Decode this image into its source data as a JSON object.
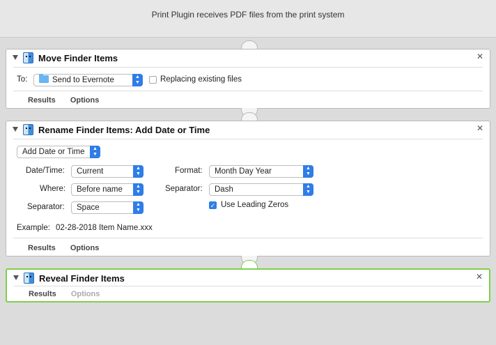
{
  "header": {
    "title": "Print Plugin receives PDF files from the print system"
  },
  "move": {
    "title": "Move Finder Items",
    "to_label": "To:",
    "to_value": "Send to Evernote",
    "replacing_label": "Replacing existing files",
    "replacing_checked": false,
    "tabs": [
      "Results",
      "Options"
    ]
  },
  "rename": {
    "title": "Rename Finder Items: Add Date or Time",
    "mode": "Add Date or Time",
    "datetime_label": "Date/Time:",
    "datetime_value": "Current",
    "where_label": "Where:",
    "where_value": "Before name",
    "separator_label": "Separator:",
    "separator_value": "Space",
    "format_label": "Format:",
    "format_value": "Month Day Year",
    "separator2_label": "Separator:",
    "separator2_value": "Dash",
    "leading_zeros_label": "Use Leading Zeros",
    "leading_zeros_checked": true,
    "example_label": "Example:",
    "example_value": "02-28-2018 Item Name.xxx",
    "tabs": [
      "Results",
      "Options"
    ]
  },
  "reveal": {
    "title": "Reveal Finder Items",
    "tabs": [
      "Results",
      "Options"
    ]
  },
  "icons": {
    "close": "close-icon",
    "disclosure": "disclosure-triangle-icon",
    "finder": "finder-icon"
  },
  "colors": {
    "accent": "#2f7de7",
    "selected_border": "#7ed04b"
  }
}
